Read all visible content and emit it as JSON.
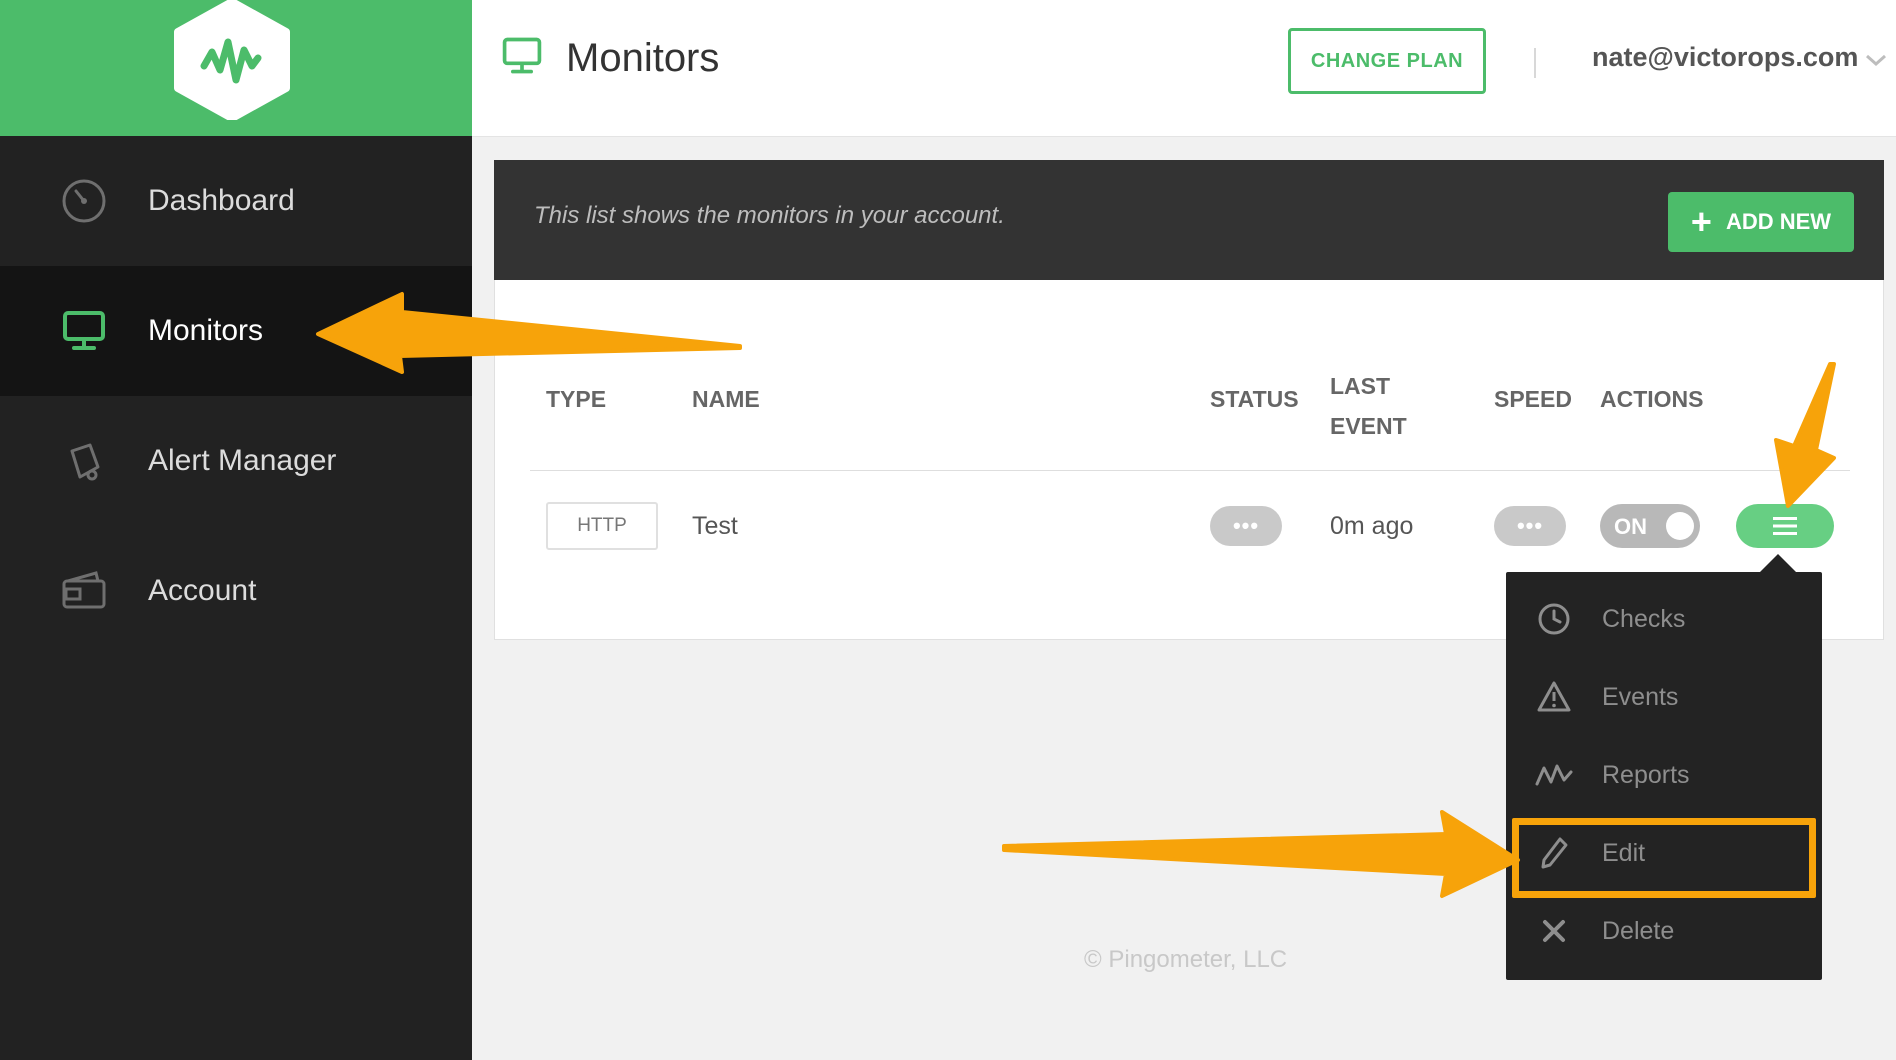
{
  "sidebar": {
    "items": [
      {
        "label": "Dashboard",
        "icon": "dashboard-gauge-icon"
      },
      {
        "label": "Monitors",
        "icon": "monitor-icon",
        "active": true
      },
      {
        "label": "Alert Manager",
        "icon": "bell-icon"
      },
      {
        "label": "Account",
        "icon": "wallet-icon"
      }
    ],
    "logo_icon": "pingometer-logo-icon"
  },
  "header": {
    "title": "Monitors",
    "change_plan_label": "CHANGE PLAN",
    "user_email": "nate@victorops.com"
  },
  "panel": {
    "description": "This list shows the monitors in your account.",
    "add_new_label": "ADD NEW"
  },
  "table": {
    "columns": {
      "type": "TYPE",
      "name": "NAME",
      "status": "STATUS",
      "last_event_1": "LAST",
      "last_event_2": "EVENT",
      "speed": "SPEED",
      "actions": "ACTIONS"
    },
    "rows": [
      {
        "type": "HTTP",
        "name": "Test",
        "status": "•••",
        "last_event": "0m ago",
        "speed": "•••",
        "toggle": "ON"
      }
    ]
  },
  "actions_menu": {
    "items": [
      {
        "label": "Checks",
        "icon": "clock-icon"
      },
      {
        "label": "Events",
        "icon": "warning-icon"
      },
      {
        "label": "Reports",
        "icon": "waveform-icon"
      },
      {
        "label": "Edit",
        "icon": "pencil-icon",
        "highlighted": true
      },
      {
        "label": "Delete",
        "icon": "close-icon"
      }
    ]
  },
  "footer": "© Pingometer, LLC",
  "colors": {
    "brand_green": "#4cbc6a",
    "annotation_orange": "#f7a30a",
    "sidebar_bg": "#222222"
  }
}
